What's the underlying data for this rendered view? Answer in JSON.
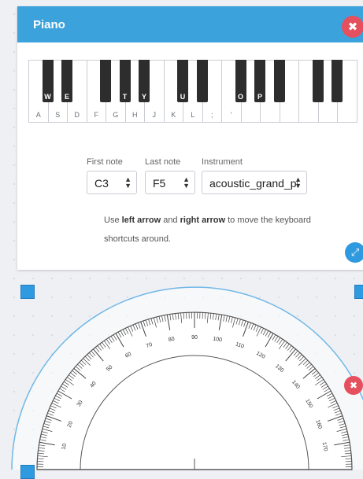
{
  "piano": {
    "title": "Piano",
    "close_icon": "close-icon",
    "expand_icon": "expand-icon",
    "white_labels": [
      "A",
      "S",
      "D",
      "F",
      "G",
      "H",
      "J",
      "K",
      "L",
      ";",
      "'",
      "",
      "",
      "",
      "",
      "",
      ""
    ],
    "black_letters": [
      "W",
      "E",
      "",
      "T",
      "Y",
      "U",
      "",
      "O",
      "P",
      "",
      "",
      "",
      "",
      "",
      "",
      ""
    ],
    "first_note": {
      "label": "First note",
      "value": "C3"
    },
    "last_note": {
      "label": "Last note",
      "value": "F5"
    },
    "instrument": {
      "label": "Instrument",
      "value": "acoustic_grand_piano"
    },
    "hint": {
      "prefix": "Use ",
      "left": "left arrow",
      "middle": " and ",
      "right": "right arrow",
      "suffix": " to move the keyboard shortcuts around."
    }
  },
  "protractor": {
    "tick_labels": [
      "10",
      "20",
      "30",
      "40",
      "50",
      "60",
      "70",
      "80",
      "90",
      "100",
      "110",
      "120",
      "130",
      "140",
      "150",
      "160",
      "170"
    ],
    "close_icon": "close-icon"
  },
  "colors": {
    "accent": "#3ba2dc",
    "close": "#e5505f"
  }
}
